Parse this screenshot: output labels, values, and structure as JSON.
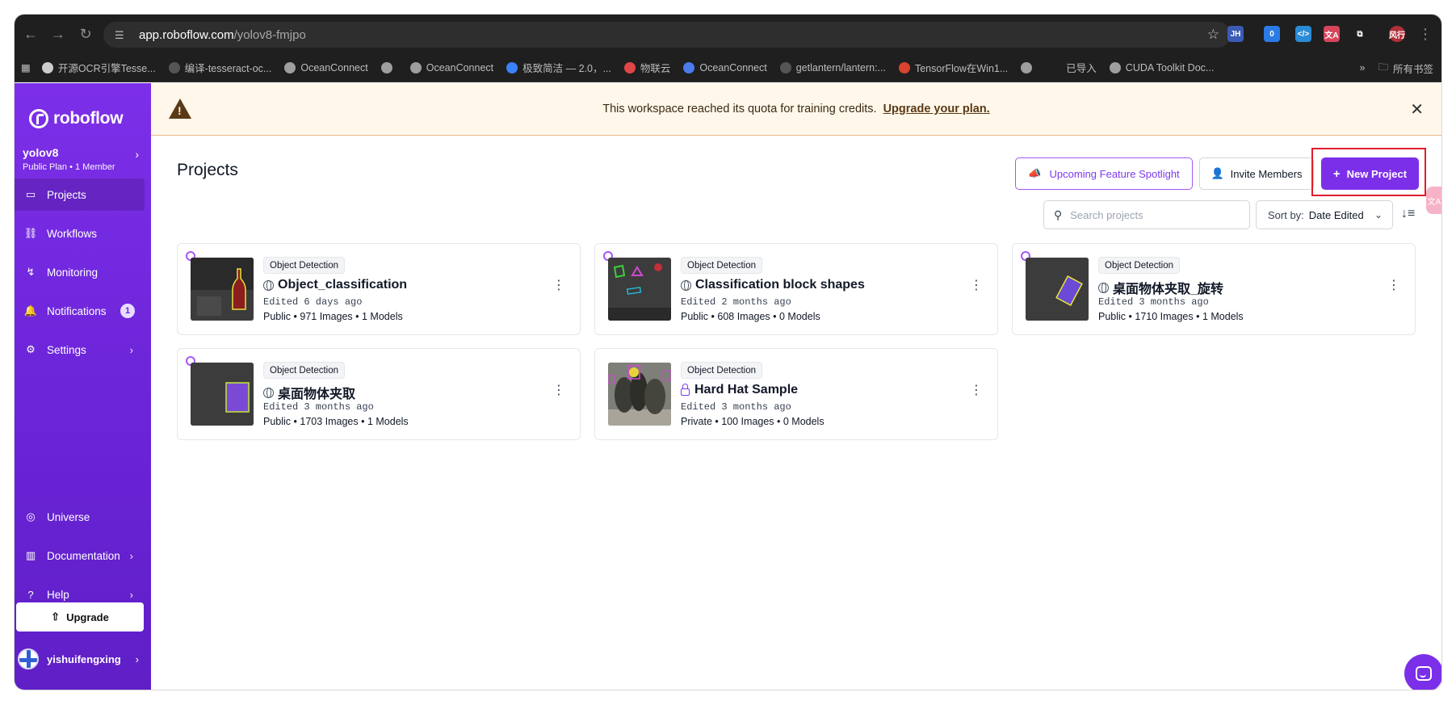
{
  "browser": {
    "url_host": "app.roboflow.com",
    "url_path": "/yolov8-fmjpo",
    "extensions": [
      {
        "name": "jh-extension-icon",
        "text": "JH",
        "color": "#3b5bb5"
      },
      {
        "name": "counter-extension-icon",
        "text": "0",
        "color": "#2c7be5"
      },
      {
        "name": "code-extension-icon",
        "text": "</>",
        "color": "#2a8bd6"
      },
      {
        "name": "translate-extension-icon",
        "text": "文A",
        "color": "#d6455b"
      },
      {
        "name": "puzzle-icon",
        "text": "⧉",
        "color": "#1f1f1f"
      },
      {
        "name": "profile-avatar-icon",
        "text": "风行",
        "color": "#b0303a"
      }
    ],
    "bookmarks": [
      {
        "label": "开源OCR引擎Tesse...",
        "color": "#cccccc"
      },
      {
        "label": "编译-tesseract-oc...",
        "color": "#555555"
      },
      {
        "label": "OceanConnect",
        "color": "#9e9e9e"
      },
      {
        "label": "",
        "color": "#9e9e9e"
      },
      {
        "label": "OceanConnect",
        "color": "#9e9e9e"
      },
      {
        "label": "极致简洁 — 2.0，...",
        "color": "#3b82f6"
      },
      {
        "label": "物联云",
        "color": "#e04646"
      },
      {
        "label": "OceanConnect",
        "color": "#4b7bec"
      },
      {
        "label": "getlantern/lantern:...",
        "color": "#555555"
      },
      {
        "label": "TensorFlow在Win1...",
        "color": "#d9432f"
      },
      {
        "label": "",
        "color": "#9e9e9e"
      },
      {
        "label": "已导入",
        "color": "#1f1f1f"
      },
      {
        "label": "CUDA Toolkit Doc...",
        "color": "#9e9e9e"
      }
    ],
    "all_bookmarks": "所有书签"
  },
  "sidebar": {
    "brand": "roboflow",
    "workspace_name": "yolov8",
    "workspace_meta": "Public Plan • 1 Member",
    "nav": [
      {
        "label": "Projects",
        "icon": "projects-icon",
        "active": true
      },
      {
        "label": "Workflows",
        "icon": "workflows-icon"
      },
      {
        "label": "Monitoring",
        "icon": "monitoring-icon"
      },
      {
        "label": "Notifications",
        "icon": "bell-icon",
        "badge": "1"
      },
      {
        "label": "Settings",
        "icon": "gear-icon",
        "chevron": true
      }
    ],
    "bottom_nav": [
      {
        "label": "Universe",
        "icon": "universe-icon"
      },
      {
        "label": "Documentation",
        "icon": "book-icon",
        "chevron": true
      },
      {
        "label": "Help",
        "icon": "help-icon",
        "chevron": true
      }
    ],
    "upgrade_label": "Upgrade",
    "user_name": "yishuifengxing"
  },
  "banner": {
    "message": "This workspace reached its quota for training credits.",
    "link": "Upgrade your plan."
  },
  "main": {
    "title": "Projects",
    "spotlight_label": "Upcoming Feature Spotlight",
    "invite_label": "Invite Members",
    "new_project_label": "New Project",
    "search_placeholder": "Search projects",
    "sort_label": "Sort by:",
    "sort_value": "Date Edited"
  },
  "projects": [
    {
      "type": "Object Detection",
      "name": "Object_classification",
      "visibility": "public",
      "edited": "Edited 6 days ago",
      "meta": "Public • 971 Images • 1 Models",
      "thumb": "bottle"
    },
    {
      "type": "Object Detection",
      "name": "Classification block shapes",
      "visibility": "public",
      "edited": "Edited 2 months ago",
      "meta": "Public • 608 Images • 0 Models",
      "thumb": "shapes"
    },
    {
      "type": "Object Detection",
      "name": "桌面物体夹取_旋转",
      "visibility": "public",
      "edited": "Edited 3 months ago",
      "meta": "Public • 1710 Images • 1 Models",
      "thumb": "rotated"
    },
    {
      "type": "Object Detection",
      "name": "桌面物体夹取",
      "visibility": "public",
      "edited": "Edited 3 months ago",
      "meta": "Public • 1703 Images • 1 Models",
      "thumb": "block"
    },
    {
      "type": "Object Detection",
      "name": "Hard Hat Sample",
      "visibility": "private",
      "edited": "Edited 3 months ago",
      "meta": "Private • 100 Images • 0 Models",
      "thumb": "workers"
    }
  ],
  "colors": {
    "brand": "#7c2fe8",
    "highlight": "#e11d2a",
    "banner_bg": "#fff7ea"
  }
}
